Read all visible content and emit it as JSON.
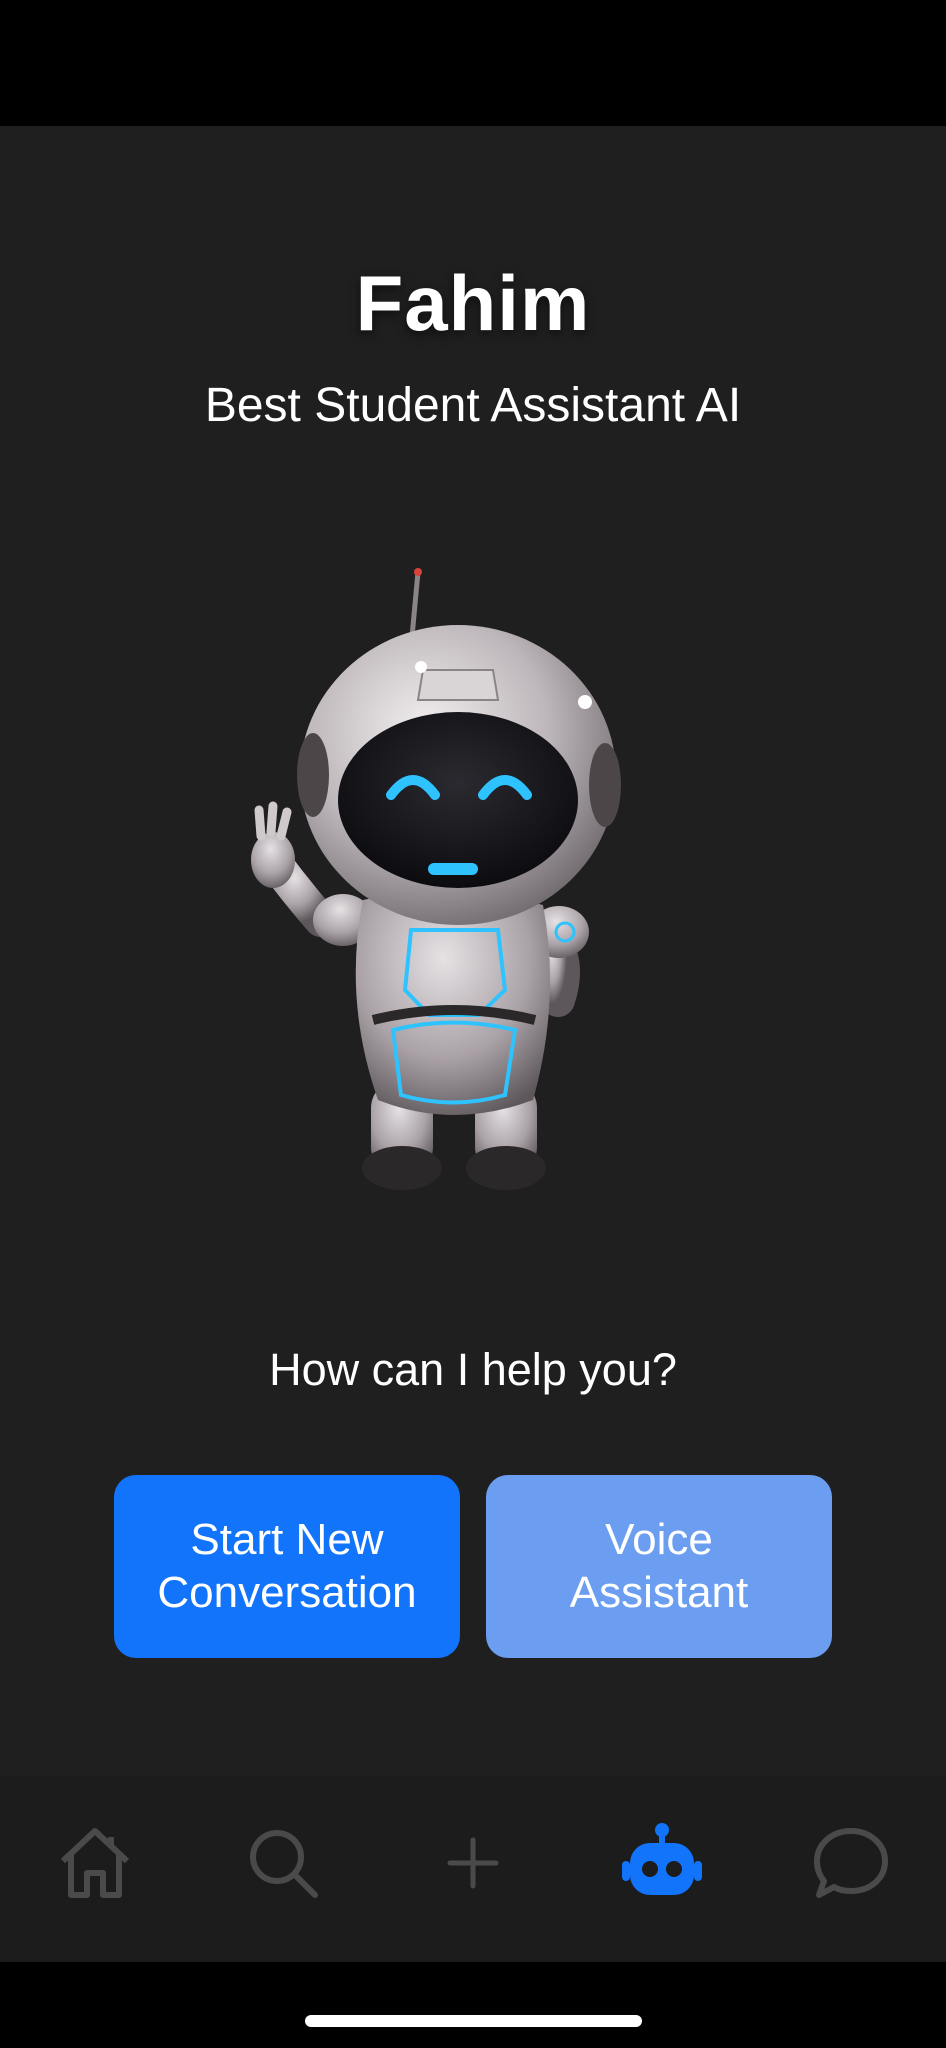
{
  "header": {
    "title": "Fahim",
    "subtitle": "Best Student Assistant AI"
  },
  "hero": {
    "image": "waving-robot-illustration"
  },
  "main": {
    "prompt": "How can I help you?",
    "start_button": "Start New\nConversation",
    "voice_button": "Voice\nAssistant"
  },
  "tabbar": {
    "items": [
      {
        "icon": "home-icon",
        "active": false
      },
      {
        "icon": "search-icon",
        "active": false
      },
      {
        "icon": "plus-icon",
        "active": false
      },
      {
        "icon": "robot-icon",
        "active": true
      },
      {
        "icon": "chat-bubble-icon",
        "active": false
      }
    ]
  },
  "colors": {
    "background": "#1f1f1f",
    "primary": "#1273fb",
    "secondary": "#6b9ef1",
    "inactive_icon": "#4a4a4a",
    "robot_glow": "#2ec3ff"
  }
}
